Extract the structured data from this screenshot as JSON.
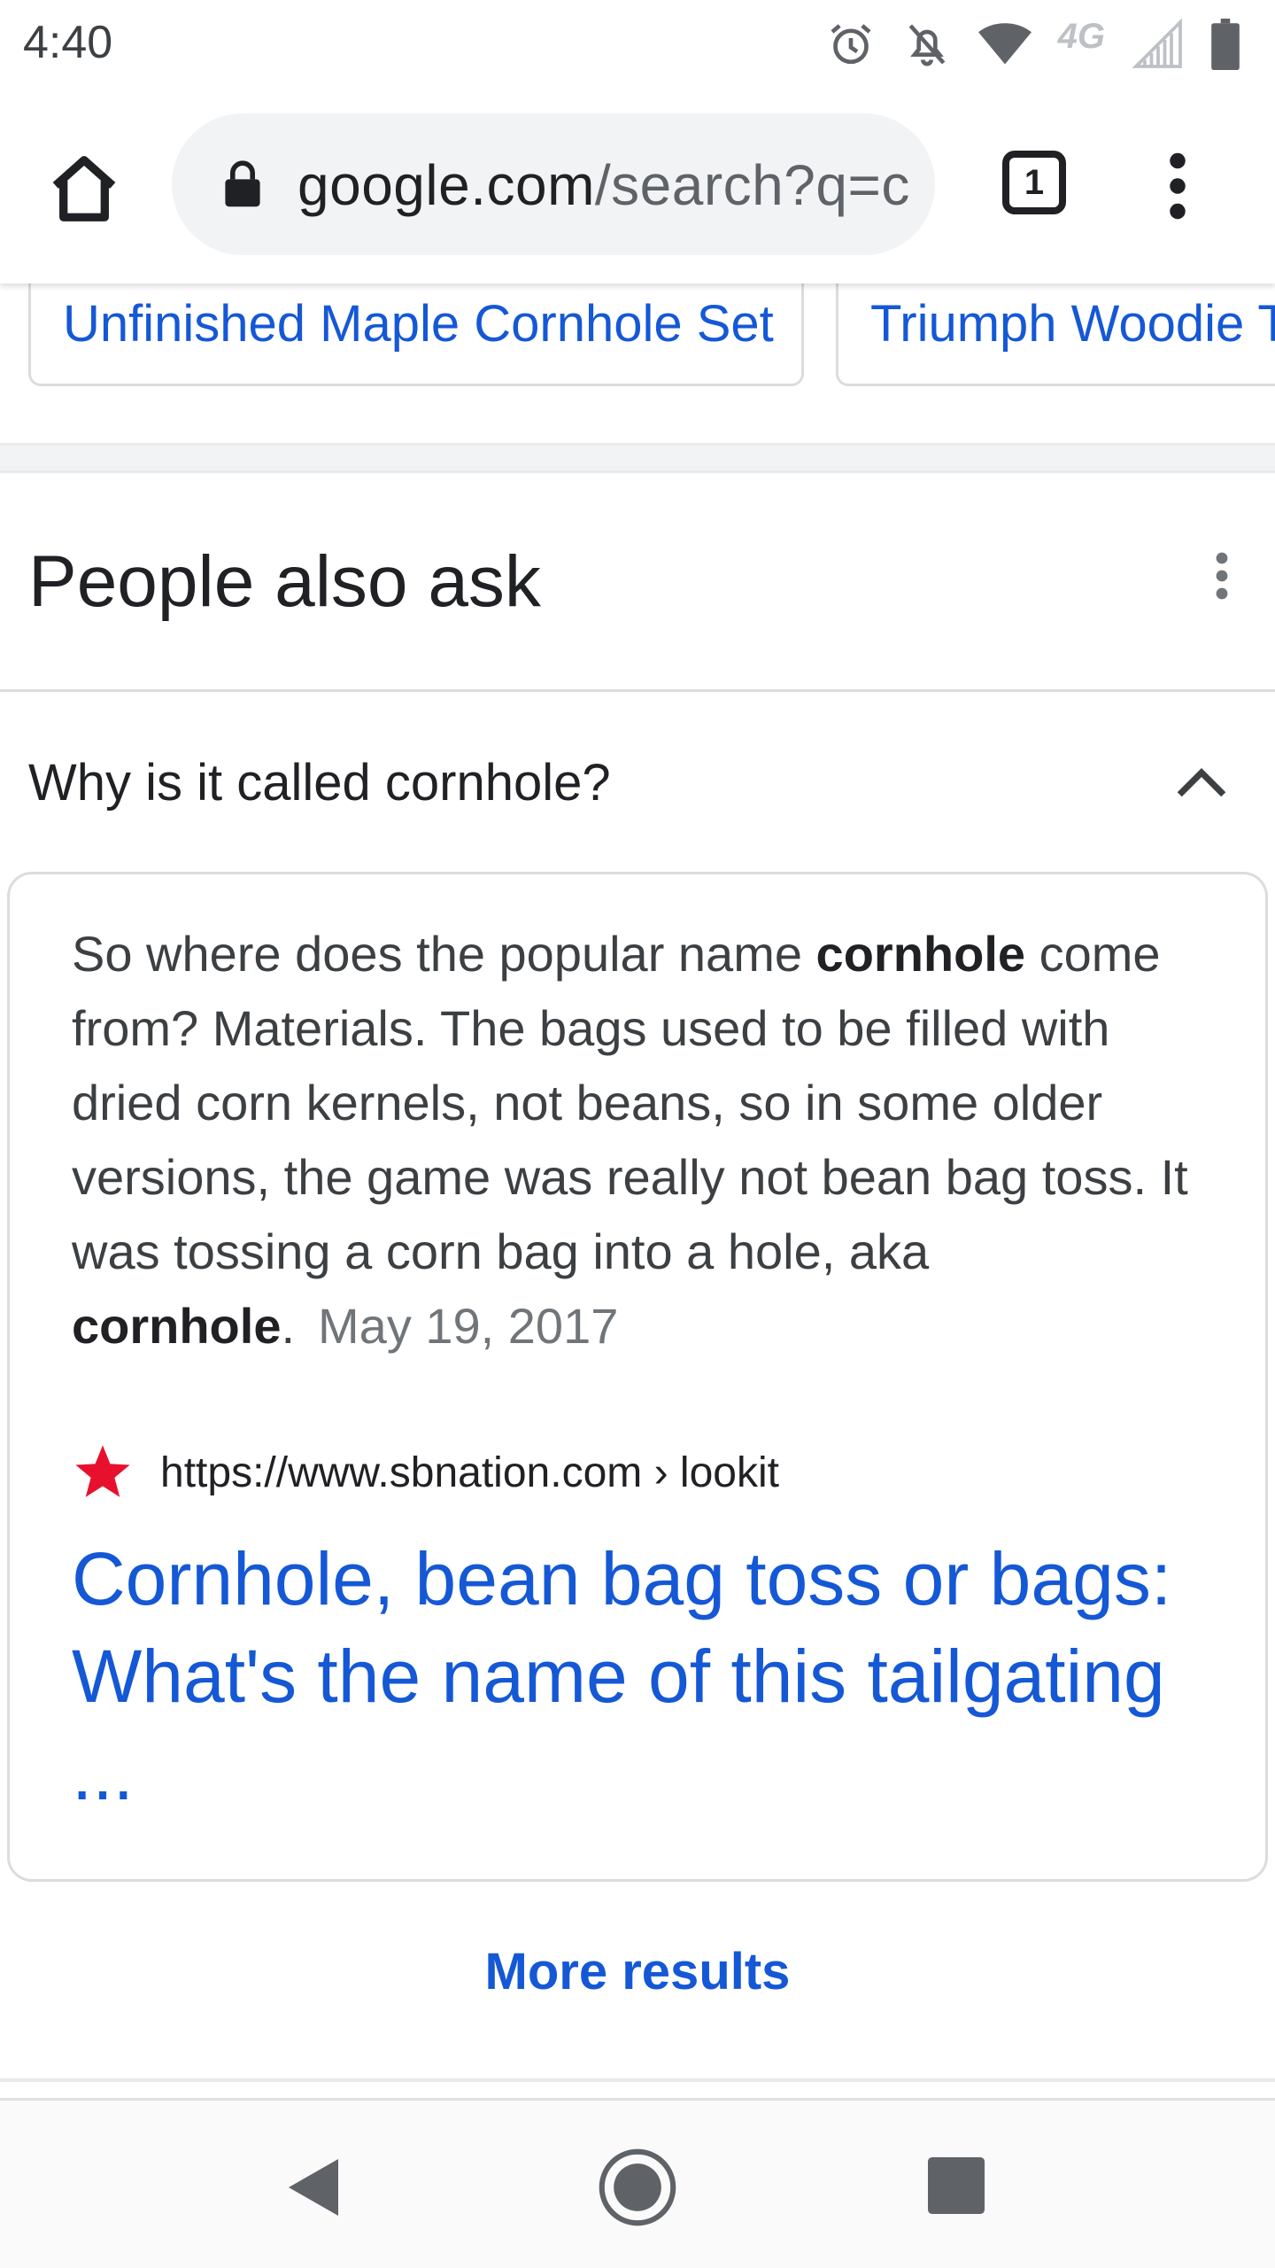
{
  "status_bar": {
    "time": "4:40",
    "network": "4G",
    "icons": [
      "alarm-icon",
      "notifications-off-icon",
      "wifi-icon",
      "network-4g-icon",
      "signal-icon",
      "battery-icon"
    ]
  },
  "toolbar": {
    "url_host": "google.com",
    "url_path": "/search?q=c",
    "tab_count": "1",
    "icons": [
      "home-icon",
      "lock-icon",
      "tab-switcher-icon",
      "more-vert-icon"
    ]
  },
  "chips": [
    {
      "label": "Unfinished Maple Cornhole Set"
    },
    {
      "label": "Triumph Woodie T"
    }
  ],
  "people_also_ask": {
    "title": "People also ask",
    "question": "Why is it called cornhole?",
    "answer": {
      "part1": "So where does the popular name ",
      "bold1": "cornhole",
      "part2": " come from? Materials. The bags used to be filled with dried corn kernels, not beans, so in some older versions, the game was really not bean bag toss. It was tossing a corn bag into a hole, aka ",
      "bold2": "cornhole",
      "part3": ".",
      "date": "May 19, 2017"
    },
    "source": {
      "url": "https://www.sbnation.com › lookit",
      "title": "Cornhole, bean bag toss or bags: What's the name of this tailgating ..."
    },
    "more_results": "More results"
  },
  "colors": {
    "link": "#1558d6",
    "text": "#202124",
    "muted": "#70757a",
    "border": "#dadce0",
    "favicon": "#e8112d"
  }
}
